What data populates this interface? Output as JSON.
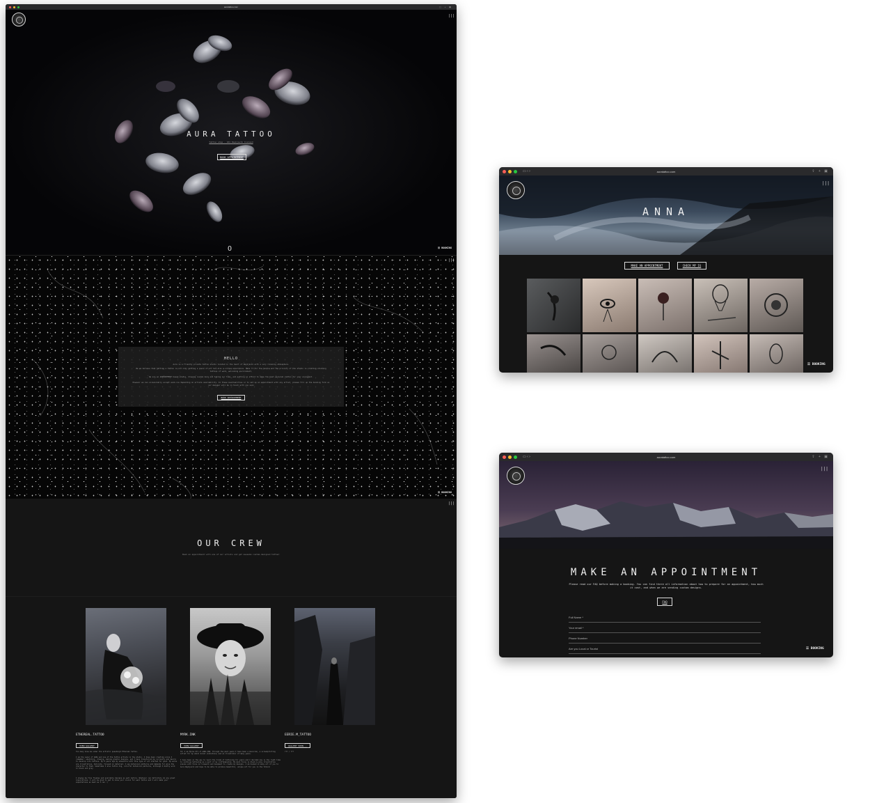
{
  "browser": {
    "main_url": "auratattoo.com",
    "right_url": "auratattoo.com",
    "icon_names": [
      "back-icon",
      "forward-icon",
      "sidebar-icon",
      "share-icon",
      "new-tab-icon",
      "tabs-icon"
    ]
  },
  "colors": {
    "page_bg": "#151515",
    "traffic_red": "#ff5f57",
    "traffic_yellow": "#febc2e",
    "traffic_green": "#28c840"
  },
  "hero": {
    "title": "AURA TATTOO",
    "subtitle": "Tattoo shop - 101 Reykjavík Iceland",
    "button": "BOOK APPOINTMENT",
    "scroll_indicator": "O",
    "booking": "BOOKING"
  },
  "hello": {
    "heading": "HELLO",
    "paragraphs": [
      "Aura is a friendly private tattoo studio located in the heart of Reykjavík with a very relaxing atmosphere.",
      "We we believe that getting a tattoo is not only getting a piece of art but also a unique experience. Make it for the people and the priority of the studio is creating stunning tattoos of warm, welcoming environment.",
      "We are an APPOINTMENT based studio, drawing custom here and taking our time, and putting in effort to make the best personal tattoo for your enjoyment.",
      "However we can occasionally accept walk-ins depending on artists availability. In these eventualities or to set up an appointment with any artist, please fill up the booking form so our manager will be in touch with you soon"
    ],
    "button": "BOOK APPOINTMENT",
    "booking": "BOOKING"
  },
  "crew": {
    "heading": "OUR CREW",
    "subheading": "Book an appointment with one of our artists and get awesome custom-designed tattoo!",
    "artists": [
      {
        "name": "ETHEREAL.TATTOO",
        "button": "VIEW GALLERY",
        "bio1": "Too many know me under the artistic pseudonym Ethereal tattoo.",
        "bio2": "I am the owner of AURA and one of the tattoo artists in the studio. I have been creating since I remember: sketching, drawing, making graphic designs, and I have transferred my curiosity and desire to develop into tattoos. My 8 years ago my adventure with this type of art started for good. My works are illustrative, delicate, focused on detailed. I use botanical patterns and demands for give the character to them. Sometimes I also tattoo big, colorful botanical patterns, although I mostly work in black and grey.",
        "bio3": "I always be fine flashes and available designs as well before. Whatever can definitely do any great inspirations. I will be glad to get to know your vision for each tattoo and I will make your expectations as best as I can :)"
      },
      {
        "name": "MYRK.INK",
        "button": "VIEW GALLERY",
        "bio1": "Hi! I am Myrka Ott of AURA INK. Through the past years I have been a musician, a screenprinting artist for my small brand (Cobraface) and an illustrator of many years.",
        "bio2": "I have been on the way to learn the trade of tattooing for years and I decided now is the right time to continue tattooing as a part of my craftsmanship. My main focus is black & grey illustrative pieces with focus on linework and movement to create my designs. I am hooked on many art of you to Aura Reykjavík and hope to be able to produce beautiful, unique art for you in the future!"
      },
      {
        "name": "EERIE.M_TATTOO",
        "button": "GALLERY SOON...",
        "bio1": "??? / ???"
      }
    ]
  },
  "anna": {
    "title": "ANNA",
    "buttons": [
      "MAKE AN APPOINTMENT",
      "CHECK MY IG"
    ],
    "booking": "BOOKING"
  },
  "appointment": {
    "title": "MAKE AN APPOINTMENT",
    "intro": "Please read our FAQ before making a booking. You can find there all information about how to prepare for an appointment, how much it cost, and when we are sending custom designs.",
    "faq_button": "FAQ",
    "fields": [
      "Full Name *",
      "Your email *",
      "Phone Number",
      "Are you Local or Tourist"
    ],
    "booking": "BOOKING"
  }
}
